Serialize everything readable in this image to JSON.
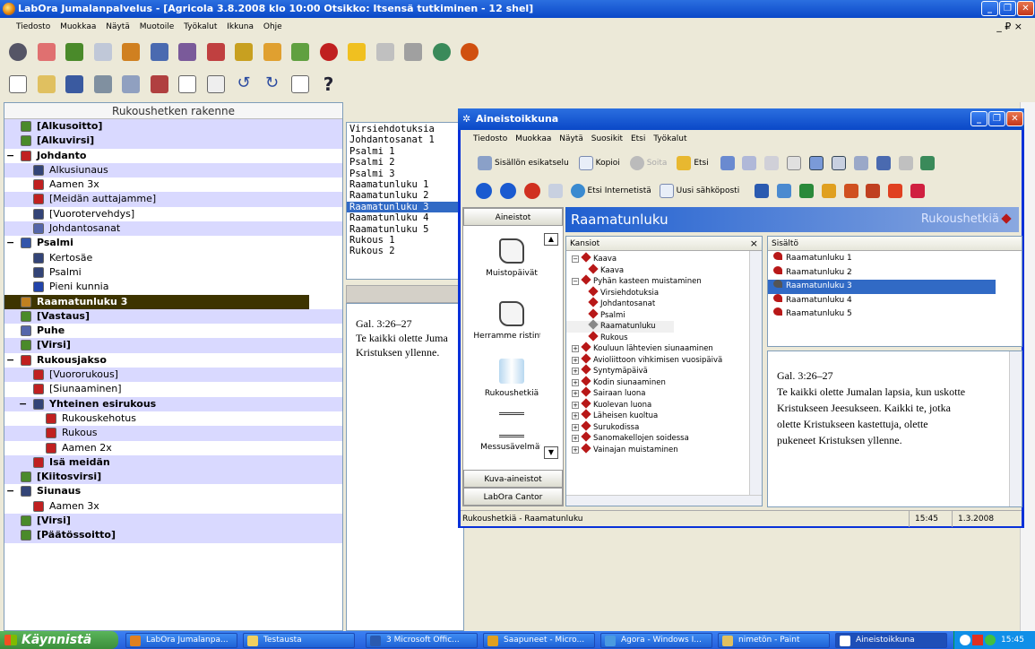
{
  "window": {
    "title": "LabOra Jumalanpalvelus - [Agricola 3.8.2008 klo 10:00 Otsikko: Itsensä tutkiminen - 12 shel]"
  },
  "menubar": {
    "items": [
      "Tiedosto",
      "Muokkaa",
      "Näytä",
      "Muotoile",
      "Työkalut",
      "Ikkuna",
      "Ohje"
    ],
    "mdi": "_ ₽ ×"
  },
  "tree": {
    "title": "Rukoushetken rakenne",
    "rows": [
      {
        "label": "[Alkusoitto]",
        "level": 0,
        "bold": true,
        "band": true,
        "color": "#4a8a2a"
      },
      {
        "label": "[Alkuvirsi]",
        "level": 0,
        "bold": true,
        "band": true,
        "color": "#4a8a2a"
      },
      {
        "label": "Johdanto",
        "level": 0,
        "bold": true,
        "band": false,
        "color": "#c02020",
        "toggle": "−"
      },
      {
        "label": "Alkusiunaus",
        "level": 1,
        "band": true,
        "color": "#334477"
      },
      {
        "label": "Aamen 3x",
        "level": 1,
        "band": false,
        "color": "#c02020"
      },
      {
        "label": "[Meidän auttajamme]",
        "level": 1,
        "band": true,
        "color": "#c02020"
      },
      {
        "label": "[Vuorotervehdys]",
        "level": 1,
        "band": false,
        "color": "#334477"
      },
      {
        "label": "Johdantosanat",
        "level": 1,
        "band": true,
        "color": "#5566aa"
      },
      {
        "label": "Psalmi",
        "level": 0,
        "bold": true,
        "band": false,
        "color": "#3355aa",
        "toggle": "−"
      },
      {
        "label": "Kertosäe",
        "level": 1,
        "band": false,
        "color": "#334477"
      },
      {
        "label": "Psalmi",
        "level": 1,
        "band": false,
        "color": "#334477"
      },
      {
        "label": "Pieni kunnia",
        "level": 1,
        "band": false,
        "color": "#2244aa"
      },
      {
        "label": "Raamatunluku 3",
        "level": 0,
        "bold": true,
        "sel": true,
        "color": "#c08020"
      },
      {
        "label": "[Vastaus]",
        "level": 0,
        "bold": true,
        "band": true,
        "color": "#4a8a2a"
      },
      {
        "label": "Puhe",
        "level": 0,
        "bold": true,
        "band": false,
        "color": "#5566aa"
      },
      {
        "label": "[Virsi]",
        "level": 0,
        "bold": true,
        "band": true,
        "color": "#4a8a2a"
      },
      {
        "label": "Rukousjakso",
        "level": 0,
        "bold": true,
        "band": false,
        "color": "#c02020",
        "toggle": "−"
      },
      {
        "label": "[Vuororukous]",
        "level": 1,
        "band": true,
        "color": "#c02020"
      },
      {
        "label": "[Siunaaminen]",
        "level": 1,
        "band": false,
        "color": "#c02020"
      },
      {
        "label": "Yhteinen esirukous",
        "level": 1,
        "bold": true,
        "band": true,
        "color": "#334477",
        "toggle": "−"
      },
      {
        "label": "Rukouskehotus",
        "level": 2,
        "band": false,
        "color": "#c02020"
      },
      {
        "label": "Rukous",
        "level": 2,
        "band": true,
        "color": "#c02020"
      },
      {
        "label": "Aamen 2x",
        "level": 2,
        "band": false,
        "color": "#c02020"
      },
      {
        "label": "Isä meidän",
        "level": 1,
        "bold": true,
        "band": true,
        "color": "#c02020"
      },
      {
        "label": "[Kiitosvirsi]",
        "level": 0,
        "bold": true,
        "band": true,
        "color": "#4a8a2a"
      },
      {
        "label": "Siunaus",
        "level": 0,
        "bold": true,
        "band": false,
        "color": "#334477",
        "toggle": "−"
      },
      {
        "label": "Aamen 3x",
        "level": 1,
        "band": false,
        "color": "#c02020"
      },
      {
        "label": "[Virsi]",
        "level": 0,
        "bold": true,
        "band": true,
        "color": "#4a8a2a"
      },
      {
        "label": "[Päätössoitto]",
        "level": 0,
        "bold": true,
        "band": true,
        "color": "#4a8a2a"
      }
    ]
  },
  "midlist": {
    "items": [
      "Virsiehdotuksia",
      "Johdantosanat 1",
      "Psalmi 1",
      "Psalmi 2",
      "Psalmi 3",
      "Raamatunluku 1",
      "Raamatunluku 2",
      "Raamatunluku 3",
      "Raamatunluku 4",
      "Raamatunluku 5",
      "Rukous 1",
      "Rukous 2"
    ],
    "selected": 7
  },
  "midtext": {
    "ref": "Gal. 3:26–27",
    "line1": "Te kaikki olette Juma",
    "line2": "Kristuksen yllenne."
  },
  "popup": {
    "title": "Aineistoikkuna",
    "menu": [
      "Tiedosto",
      "Muokkaa",
      "Näytä",
      "Suosikit",
      "Etsi",
      "Työkalut"
    ],
    "tb1": {
      "preview": "Sisällön esikatselu",
      "copy": "Kopioi",
      "play": "Soita",
      "search": "Etsi"
    },
    "tb2": {
      "internet": "Etsi Internetistä",
      "email": "Uusi sähköposti"
    },
    "nav": {
      "top": "Aineistot",
      "items": [
        "Muistopäivät",
        "Herramme ristintie",
        "Rukoushetkiä",
        "Messusävelmät"
      ],
      "bottom": [
        "Kuva-aineistot",
        "LabOra Cantor"
      ]
    },
    "header": {
      "title": "Raamatunluku",
      "right": "Rukoushetkiä"
    },
    "folders": {
      "title": "Kansiot",
      "close": "×",
      "items": [
        {
          "label": "Kaava",
          "indent": 0,
          "toggle": "−"
        },
        {
          "label": "Kaava",
          "indent": 1
        },
        {
          "label": "Pyhän kasteen muistaminen",
          "indent": 0,
          "toggle": "−"
        },
        {
          "label": "Virsiehdotuksia",
          "indent": 1
        },
        {
          "label": "Johdantosanat",
          "indent": 1
        },
        {
          "label": "Psalmi",
          "indent": 1
        },
        {
          "label": "Raamatunluku",
          "indent": 1,
          "open": true
        },
        {
          "label": "Rukous",
          "indent": 1
        },
        {
          "label": "Kouluun lähtevien siunaaminen",
          "indent": 0,
          "toggle": "+"
        },
        {
          "label": "Avioliittoon vihkimisen vuosipäivä",
          "indent": 0,
          "toggle": "+"
        },
        {
          "label": "Syntymäpäivä",
          "indent": 0,
          "toggle": "+"
        },
        {
          "label": "Kodin siunaaminen",
          "indent": 0,
          "toggle": "+"
        },
        {
          "label": "Sairaan luona",
          "indent": 0,
          "toggle": "+"
        },
        {
          "label": "Kuolevan luona",
          "indent": 0,
          "toggle": "+"
        },
        {
          "label": "Läheisen kuoltua",
          "indent": 0,
          "toggle": "+"
        },
        {
          "label": "Surukodissa",
          "indent": 0,
          "toggle": "+"
        },
        {
          "label": "Sanomakellojen soidessa",
          "indent": 0,
          "toggle": "+"
        },
        {
          "label": "Vainajan muistaminen",
          "indent": 0,
          "toggle": "+"
        }
      ]
    },
    "content": {
      "title": "Sisältö",
      "items": [
        "Raamatunluku 1",
        "Raamatunluku 2",
        "Raamatunluku 3",
        "Raamatunluku 4",
        "Raamatunluku 5"
      ],
      "selected": 2
    },
    "text": {
      "ref": "Gal. 3:26–27",
      "l1": "Te kaikki olette Jumalan lapsia, kun uskotte",
      "l2": "Kristukseen Jeesukseen. Kaikki te, jotka",
      "l3": "olette Kristukseen kastettuja, olette",
      "l4": "pukeneet Kristuksen yllenne."
    },
    "status": {
      "text": "Rukoushetkiä - Raamatunluku",
      "time": "15:45",
      "date": "1.3.2008"
    }
  },
  "taskbar": {
    "start": "Käynnistä",
    "tasks": [
      "LabOra Jumalanpa...",
      "Testausta",
      "3 Microsoft Offic...",
      "Saapuneet - Micro...",
      "Agora - Windows I...",
      "nimetön - Paint",
      "Aineistoikkuna"
    ],
    "clock": "15:45"
  }
}
